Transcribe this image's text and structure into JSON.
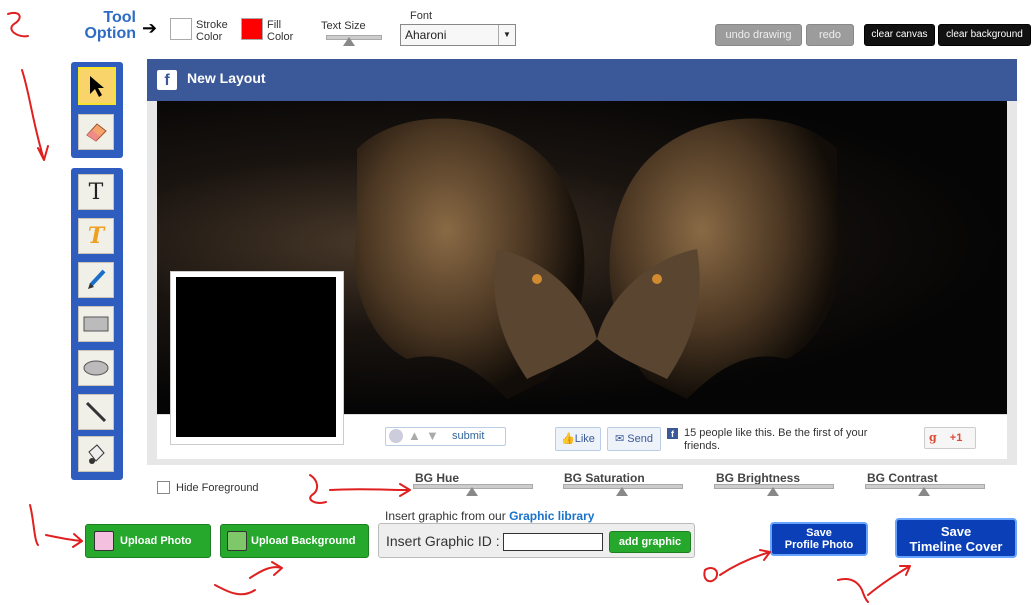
{
  "toolbar": {
    "title_line1": "Tool",
    "title_line2": "Option",
    "stroke_label_1": "Stroke",
    "stroke_label_2": "Color",
    "fill_label_1": "Fill",
    "fill_label_2": "Color",
    "text_size_label": "Text Size",
    "font_label": "Font",
    "font_value": "Aharoni",
    "undo_label": "undo drawing",
    "redo_label": "redo",
    "clear_canvas_label": "clear canvas",
    "clear_background_label": "clear background",
    "stroke_color": "#ffffff",
    "fill_color": "#ff0000"
  },
  "tools": [
    "pointer",
    "eraser",
    "text",
    "text-styled",
    "brush",
    "rectangle",
    "ellipse",
    "line",
    "fill-bucket"
  ],
  "cover": {
    "title": "New Layout",
    "like_text": "15 people like this. Be the first of your friends.",
    "like_button": "Like",
    "send_button": "Send",
    "gplus_label": "+1",
    "submit_label": "submit"
  },
  "controls": {
    "hide_foreground_label": "Hide Foreground",
    "bg_hue": "BG Hue",
    "bg_saturation": "BG Saturation",
    "bg_brightness": "BG Brightness",
    "bg_contrast": "BG Contrast",
    "graphic_prompt": "Insert graphic from our",
    "graphic_link": "Graphic library",
    "graphic_id_label": "Insert Graphic ID :",
    "graphic_id_value": "",
    "add_graphic": "add graphic",
    "upload_photo": "Upload  Photo",
    "upload_background": "Upload Background",
    "save_profile_1": "Save",
    "save_profile_2": "Profile Photo",
    "save_timeline_1": "Save",
    "save_timeline_2": "Timeline Cover"
  }
}
